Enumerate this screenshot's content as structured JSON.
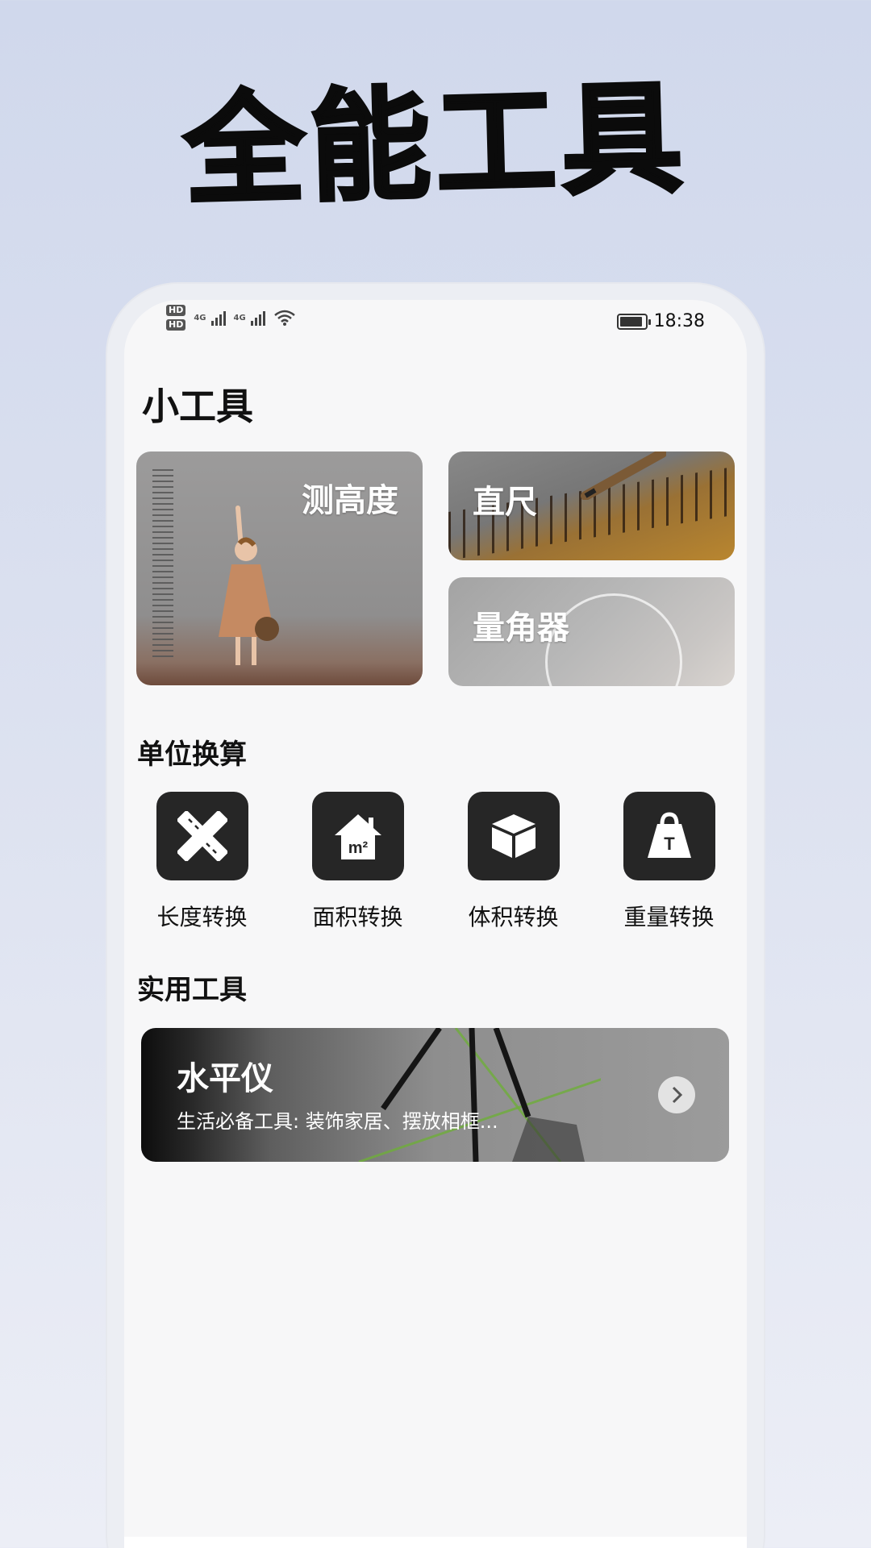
{
  "headline": "全能工具",
  "status_bar": {
    "hd1": "HD",
    "hd2": "HD",
    "net1": "4G",
    "net2": "4G",
    "battery_level": 0.9,
    "time": "18:38"
  },
  "page_title": "小工具",
  "tools": {
    "height": "测高度",
    "ruler": "直尺",
    "protractor": "量角器"
  },
  "unit_section": {
    "title": "单位换算",
    "items": [
      {
        "label": "长度转换",
        "icon": "ruler-pencil-icon"
      },
      {
        "label": "面积转换",
        "icon": "house-m2-icon"
      },
      {
        "label": "体积转换",
        "icon": "cube-icon"
      },
      {
        "label": "重量转换",
        "icon": "weight-icon"
      }
    ]
  },
  "practical_section": {
    "title": "实用工具",
    "level": {
      "title": "水平仪",
      "desc": "生活必备工具: 装饰家居、摆放相框..."
    }
  },
  "icon_text": {
    "area_unit": "m²",
    "weight_unit": "T"
  }
}
